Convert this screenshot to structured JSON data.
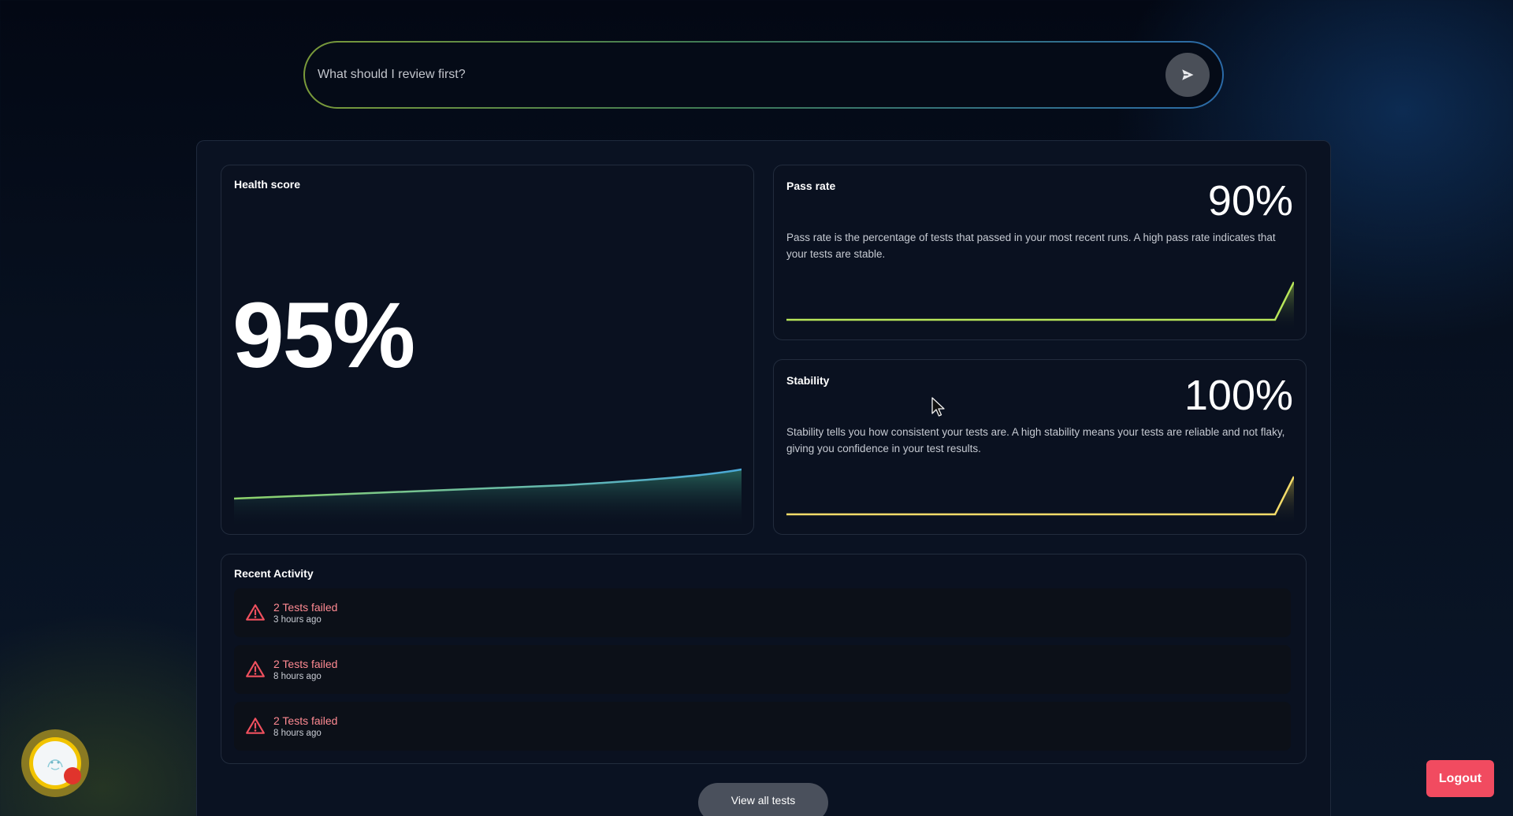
{
  "search": {
    "placeholder": "What should I review first?"
  },
  "health": {
    "title": "Health score",
    "value": "95%"
  },
  "pass_rate": {
    "title": "Pass rate",
    "value": "90%",
    "description": "Pass rate is the percentage of tests that passed in your most recent runs. A high pass rate indicates that your tests are stable."
  },
  "stability": {
    "title": "Stability",
    "value": "100%",
    "description": "Stability tells you how consistent your tests are. A high stability means your tests are reliable and not flaky, giving you confidence in your test results."
  },
  "activity": {
    "title": "Recent Activity",
    "items": [
      {
        "title": "2 Tests failed",
        "time": "3 hours ago"
      },
      {
        "title": "2 Tests failed",
        "time": "8 hours ago"
      },
      {
        "title": "2 Tests failed",
        "time": "8 hours ago"
      }
    ]
  },
  "buttons": {
    "view_all": "View all tests",
    "logout": "Logout"
  },
  "icons": {
    "send": "send-icon",
    "warning": "warning-triangle-icon",
    "avatar": "assistant-avatar-icon"
  },
  "colors": {
    "logout": "#f14b60",
    "alert": "#ff8a92",
    "pass_line": "#b8e65a",
    "stability_line": "#f5dc6a",
    "health_line_start": "#8fd46a",
    "health_line_end": "#4aa8d8"
  }
}
